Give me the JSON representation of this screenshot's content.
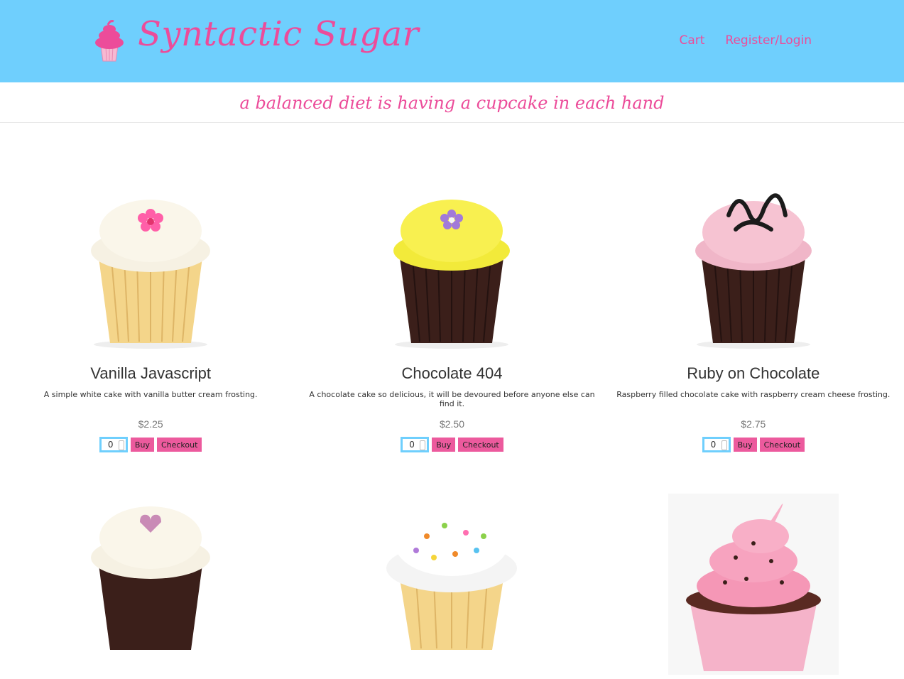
{
  "brand": {
    "name": "Syntactic Sugar",
    "logo": "cupcake-logo-icon"
  },
  "nav": {
    "cart": "Cart",
    "login": "Register/Login"
  },
  "tagline": "a balanced diet is having a cupcake in each hand",
  "products": [
    {
      "name": "Vanilla Javascript",
      "description": "A simple white cake with vanilla butter cream frosting.",
      "price": "$2.25",
      "qty": "0",
      "buy": "Buy",
      "checkout": "Checkout"
    },
    {
      "name": "Chocolate 404",
      "description": "A chocolate cake so delicious, it will be devoured before anyone else can find it.",
      "price": "$2.50",
      "qty": "0",
      "buy": "Buy",
      "checkout": "Checkout"
    },
    {
      "name": "Ruby on Chocolate",
      "description": "Raspberry filled chocolate cake with raspberry cream cheese frosting.",
      "price": "$2.75",
      "qty": "0",
      "buy": "Buy",
      "checkout": "Checkout"
    }
  ],
  "colors": {
    "header": "#6fcffd",
    "accent": "#ec4c9a"
  }
}
